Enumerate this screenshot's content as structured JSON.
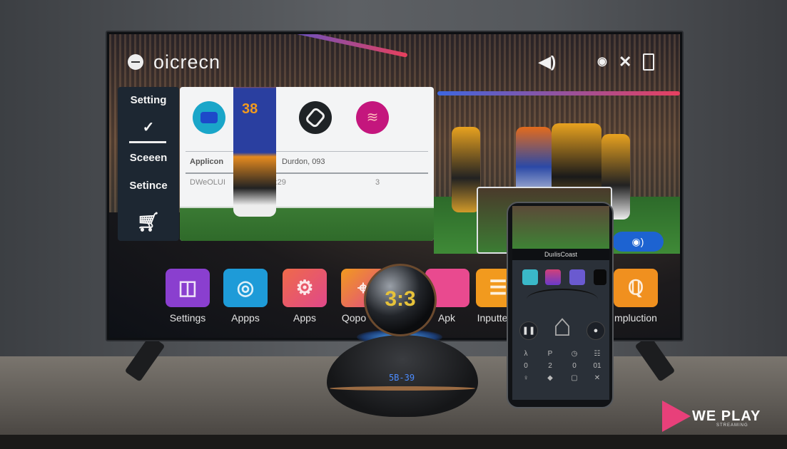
{
  "tv_ui": {
    "title": "oicrecn",
    "top_icons": [
      "sound-icon",
      "record-icon",
      "close-icon",
      "phone-icon"
    ],
    "sidebar": {
      "items": [
        {
          "label": "Setting"
        },
        {
          "label": "Sceeen"
        },
        {
          "label": "Setince"
        }
      ],
      "icons": [
        "check-icon",
        "cart-icon"
      ]
    },
    "card": {
      "app_icons": [
        {
          "name": "blue-app",
          "color": "#1aa6c9"
        },
        {
          "name": "dark-app",
          "color": "#1f2326"
        },
        {
          "name": "wifi-app",
          "color": "#c4167d"
        }
      ],
      "rows": [
        {
          "col1": "Applicon",
          "col2": "Durdon, 093"
        },
        {
          "col1": "DWeOLUI    OOU   D 10:29",
          "col2": "3"
        }
      ]
    },
    "apps": [
      {
        "label": "Settings",
        "color": "#8a3fcf"
      },
      {
        "label": "Appps",
        "color": "#1e9bd8"
      },
      {
        "label": "Apps",
        "color": "#e0488a"
      },
      {
        "label": "Qopo",
        "color": "#ef6a4a"
      },
      {
        "label": "Apk",
        "color": "#e94a8f"
      },
      {
        "label": "Inputte",
        "color": "#f29a1e"
      },
      {
        "label": "mpluction",
        "color": "#f0901f"
      }
    ]
  },
  "speaker": {
    "globe_display": "3:3",
    "base_display": "5B-39"
  },
  "phone": {
    "app_name": "DuılisCoast",
    "keypad": [
      [
        "λ",
        "P",
        "◷",
        "☷"
      ],
      [
        "0",
        "2",
        "0",
        "01"
      ],
      [
        "♀",
        "◆",
        "▢",
        "✕"
      ]
    ]
  },
  "watermark": {
    "brand": "WE PLAY",
    "sub": "STREAMING"
  }
}
